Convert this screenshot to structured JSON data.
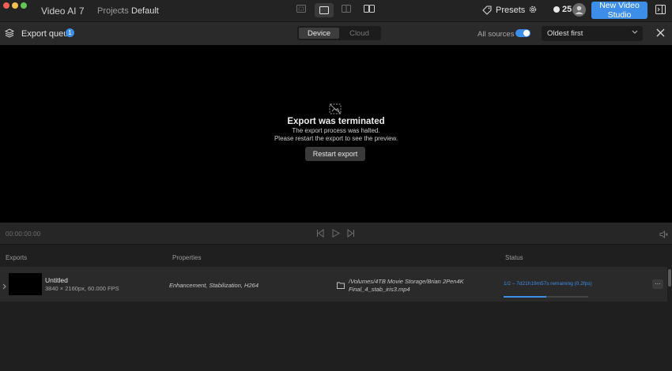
{
  "titlebar": {
    "app_title": "Video AI  7",
    "breadcrumb": {
      "projects": "Projects",
      "separator": "›",
      "current": "Default"
    },
    "presets_label": "Presets",
    "credits_count": "25",
    "new_studio_label": "New Video Studio"
  },
  "toolbar": {
    "queue_label": "Export queue",
    "queue_count": "1",
    "segments": {
      "device": "Device",
      "cloud": "Cloud"
    },
    "sources_label": "All sources",
    "sources_enabled": true,
    "sort_value": "Oldest first"
  },
  "preview": {
    "title": "Export was terminated",
    "line1": "The export process was halted.",
    "line2": "Please restart the export to see the preview.",
    "restart_label": "Restart export"
  },
  "playback": {
    "timecode": "00:00:00:00"
  },
  "table": {
    "headers": {
      "exports": "Exports",
      "properties": "Properties",
      "status": "Status"
    },
    "rows": [
      {
        "title": "Untitled",
        "meta": "3840 × 2160px, 60.000 FPS",
        "properties": "Enhancement, Stabilization, H264",
        "path_line1": "/Volumes/4TB Movie Storage/Brian 2Pen4K",
        "path_line2": "Final_4_stab_iris3.mp4",
        "status": "1/2 –  7d21h19m57s remaining (0.2fps)",
        "progress": 0.5,
        "more_label": "···"
      }
    ]
  },
  "colors": {
    "accent": "#3c8ee8",
    "background": "#1f1f1f",
    "preview_bg": "#000000"
  }
}
